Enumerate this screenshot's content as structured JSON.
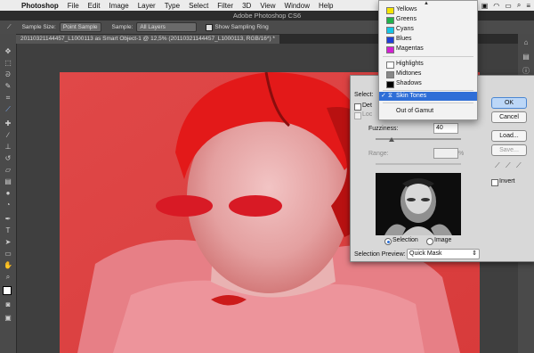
{
  "menubar": {
    "app_name": "Photoshop",
    "items": [
      "File",
      "Edit",
      "Image",
      "Layer",
      "Type",
      "Select",
      "Filter",
      "3D",
      "View",
      "Window",
      "Help"
    ],
    "clock_fragment": "7"
  },
  "window_title": "Adobe Photoshop CS6",
  "options_bar": {
    "sample_size_label": "Sample Size:",
    "sample_size_value": "Point Sample",
    "sample_label": "Sample:",
    "sample_value": "All Layers",
    "show_ring_label": "Show Sampling Ring"
  },
  "document_tab": "20110321144457_L1000113 as Smart Object-1 @ 12,5% (20110321144457_L1000113, RGB/16*) *",
  "dialog": {
    "select_label": "Select:",
    "detect_label": "Det",
    "localized_label": "Loc",
    "fuzziness_label": "Fuzziness:",
    "fuzziness_value": "40",
    "range_label": "Range:",
    "range_unit": "%",
    "selection_radio": "Selection",
    "image_radio": "Image",
    "preview_label": "Selection Preview:",
    "preview_value": "Quick Mask",
    "buttons": {
      "ok": "OK",
      "cancel": "Cancel",
      "load": "Load...",
      "save": "Save..."
    },
    "invert_label": "Invert"
  },
  "dropdown": {
    "colors": [
      {
        "label": "Yellows",
        "color": "#f4e400"
      },
      {
        "label": "Greens",
        "color": "#22b14c"
      },
      {
        "label": "Cyans",
        "color": "#14c4e6"
      },
      {
        "label": "Blues",
        "color": "#1f3ed6"
      },
      {
        "label": "Magentas",
        "color": "#d21fd2"
      }
    ],
    "tones": [
      {
        "label": "Highlights",
        "color": "#ffffff"
      },
      {
        "label": "Midtones",
        "color": "#888888"
      },
      {
        "label": "Shadows",
        "color": "#000000"
      }
    ],
    "selected": "Skin Tones",
    "out_of_gamut": "Out of Gamut"
  },
  "accent_color": "#2f6ed7"
}
